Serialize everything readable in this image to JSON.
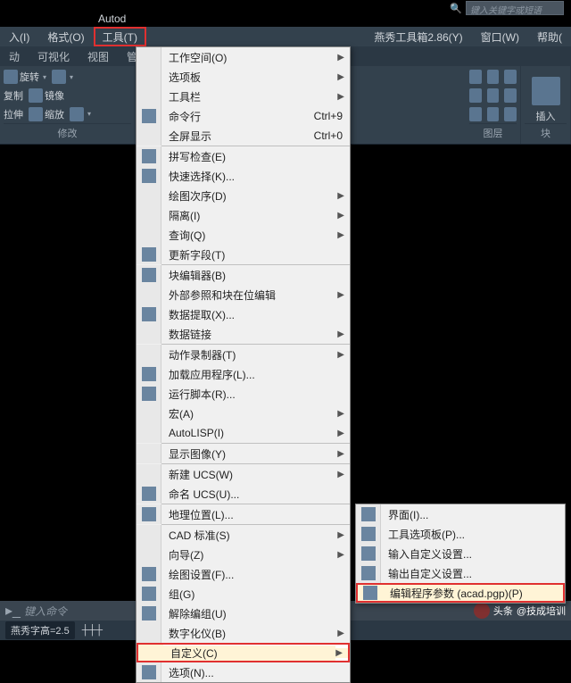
{
  "app_title": "Autod",
  "search": {
    "placeholder": "键入关键字或短语"
  },
  "menubar": {
    "items": [
      "入(I)",
      "格式(O)",
      "工具(T)",
      "",
      "燕秀工具箱2.86(Y)",
      "窗口(W)",
      "帮助("
    ],
    "highlighted_index": 2
  },
  "ribbon_tabs": [
    "动",
    "可视化",
    "视图",
    "管理",
    "",
    "图层",
    "块"
  ],
  "ribbon": {
    "panel1": {
      "btns": [
        "旋转",
        "镜像",
        "缩放"
      ],
      "small": [
        "复制",
        "拉伸"
      ],
      "label": "修改"
    },
    "panel_insert": {
      "label": "插入"
    },
    "panel_layer": {
      "label": "图层"
    },
    "panel_block": {
      "label": "块"
    }
  },
  "dropdown": {
    "items": [
      {
        "label": "工作空间(O)",
        "arrow": true
      },
      {
        "label": "选项板",
        "arrow": true
      },
      {
        "label": "工具栏",
        "arrow": true
      },
      {
        "label": "命令行",
        "shortcut": "Ctrl+9",
        "icon": "cli-icon"
      },
      {
        "label": "全屏显示",
        "shortcut": "Ctrl+0"
      },
      {
        "sep": true
      },
      {
        "label": "拼写检查(E)",
        "icon": "spell-icon"
      },
      {
        "label": "快速选择(K)...",
        "icon": "qselect-icon"
      },
      {
        "label": "绘图次序(D)",
        "arrow": true
      },
      {
        "label": "隔离(I)",
        "arrow": true
      },
      {
        "label": "查询(Q)",
        "arrow": true
      },
      {
        "label": "更新字段(T)",
        "icon": "field-icon"
      },
      {
        "sep": true
      },
      {
        "label": "块编辑器(B)",
        "icon": "block-icon"
      },
      {
        "label": "外部参照和块在位编辑",
        "arrow": true
      },
      {
        "label": "数据提取(X)...",
        "icon": "data-icon"
      },
      {
        "label": "数据链接",
        "arrow": true
      },
      {
        "sep": true
      },
      {
        "label": "动作录制器(T)",
        "arrow": true
      },
      {
        "label": "加载应用程序(L)...",
        "icon": "load-icon"
      },
      {
        "label": "运行脚本(R)...",
        "icon": "script-icon"
      },
      {
        "label": "宏(A)",
        "arrow": true
      },
      {
        "label": "AutoLISP(I)",
        "arrow": true
      },
      {
        "sep": true
      },
      {
        "label": "显示图像(Y)",
        "arrow": true
      },
      {
        "sep": true
      },
      {
        "label": "新建 UCS(W)",
        "arrow": true
      },
      {
        "label": "命名 UCS(U)...",
        "icon": "ucs-icon"
      },
      {
        "sep": true
      },
      {
        "label": "地理位置(L)...",
        "icon": "geo-icon"
      },
      {
        "sep": true
      },
      {
        "label": "CAD 标准(S)",
        "arrow": true
      },
      {
        "label": "向导(Z)",
        "arrow": true
      },
      {
        "label": "绘图设置(F)...",
        "icon": "draft-icon"
      },
      {
        "label": "组(G)",
        "icon": "group-icon"
      },
      {
        "label": "解除编组(U)",
        "icon": "ungroup-icon"
      },
      {
        "label": "数字化仪(B)",
        "arrow": true
      },
      {
        "label": "自定义(C)",
        "arrow": true,
        "highlighted": true
      },
      {
        "label": "选项(N)...",
        "icon": "opt-icon"
      }
    ]
  },
  "submenu": {
    "items": [
      {
        "label": "界面(I)...",
        "icon": "ui-icon"
      },
      {
        "label": "工具选项板(P)...",
        "icon": "palette-icon"
      },
      {
        "label": "输入自定义设置...",
        "icon": "import-icon"
      },
      {
        "label": "输出自定义设置...",
        "icon": "export-icon"
      },
      {
        "label": "编辑程序参数 (acad.pgp)(P)",
        "icon": "pgp-icon",
        "highlighted": true
      }
    ]
  },
  "cmdline": {
    "prompt": "键入命令"
  },
  "status": {
    "left": "燕秀字高=2.5",
    "grid": "┼┼┼"
  },
  "watermark": {
    "source": "头条",
    "author": "@技成培训"
  }
}
